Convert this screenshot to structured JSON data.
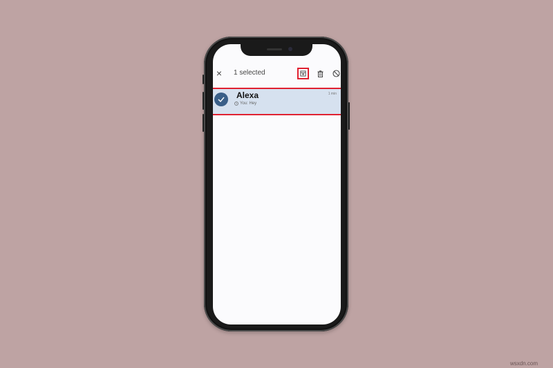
{
  "header": {
    "selected_text": "1 selected",
    "close_icon": "×"
  },
  "actions": [
    {
      "name": "archive",
      "highlighted": true
    },
    {
      "name": "delete"
    },
    {
      "name": "block"
    }
  ],
  "conversation": {
    "name": "Alexa",
    "time": "1 min",
    "preview": "You: Hey",
    "selected": true
  },
  "colors": {
    "background": "#bea3a3",
    "highlight": "#e02030",
    "selected_row": "#d6e1ef",
    "avatar_check": "#3a5f88"
  },
  "watermark": "wsxdn.com"
}
